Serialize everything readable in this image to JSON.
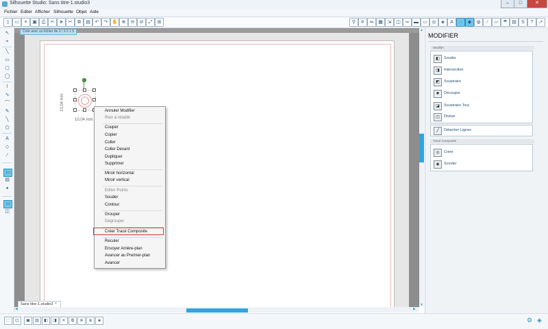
{
  "window": {
    "title": "Silhouette Studio: Sans titre-1.studio3",
    "minimize": "–",
    "maximize": "□",
    "close": "✕"
  },
  "menu": [
    "Fichier",
    "Editer",
    "Afficher",
    "Silhouette",
    "Objet",
    "Aide"
  ],
  "document": {
    "page_label": "Créé avec un fichier de 3 / 3 2 1 5",
    "tab_label": "Sans titre-1.studio3",
    "tab_close": "×"
  },
  "selection": {
    "width_label": "10,04 mm",
    "height_label": "10,04 mm"
  },
  "context_menu": {
    "items": [
      {
        "label": "Annuler Modifier",
        "enabled": true
      },
      {
        "label": "Rien à rétablir",
        "enabled": false
      },
      {
        "label": "Couper",
        "enabled": true
      },
      {
        "label": "Copier",
        "enabled": true
      },
      {
        "label": "Coller",
        "enabled": true
      },
      {
        "label": "Coller Devant",
        "enabled": true
      },
      {
        "label": "Dupliquer",
        "enabled": true
      },
      {
        "label": "Supprimer",
        "enabled": true
      },
      {
        "label": "Miroir horizontal",
        "enabled": true
      },
      {
        "label": "Miroir vertical",
        "enabled": true
      },
      {
        "label": "Editer Points",
        "enabled": false
      },
      {
        "label": "Souder",
        "enabled": true
      },
      {
        "label": "Contour",
        "enabled": true
      },
      {
        "label": "Grouper",
        "enabled": true
      },
      {
        "label": "Dégrouper",
        "enabled": false
      },
      {
        "label": "Créer Tracé Composite",
        "enabled": true,
        "highlighted": true
      },
      {
        "label": "Reculer",
        "enabled": true
      },
      {
        "label": "Envoyer Arrière-plan",
        "enabled": true
      },
      {
        "label": "Avancer au Premier-plan",
        "enabled": true
      },
      {
        "label": "Avancer",
        "enabled": true
      }
    ]
  },
  "right_panel": {
    "title": "MODIFIER",
    "section_modifier": "Modifier",
    "modifier_items": [
      "Souder",
      "Intersection",
      "Soustraire",
      "Découper",
      "Soustraire Tout",
      "Diviser"
    ],
    "detach_label": "Détacher Lignes",
    "section_compound": "Tracé Composite",
    "compound_items": [
      "Créer",
      "Scinder"
    ]
  },
  "colors": {
    "accent": "#2fa6df",
    "highlight_border": "#d93838",
    "canvas_gray": "#9a9a9a",
    "rotate_handle": "#3aa23a"
  }
}
